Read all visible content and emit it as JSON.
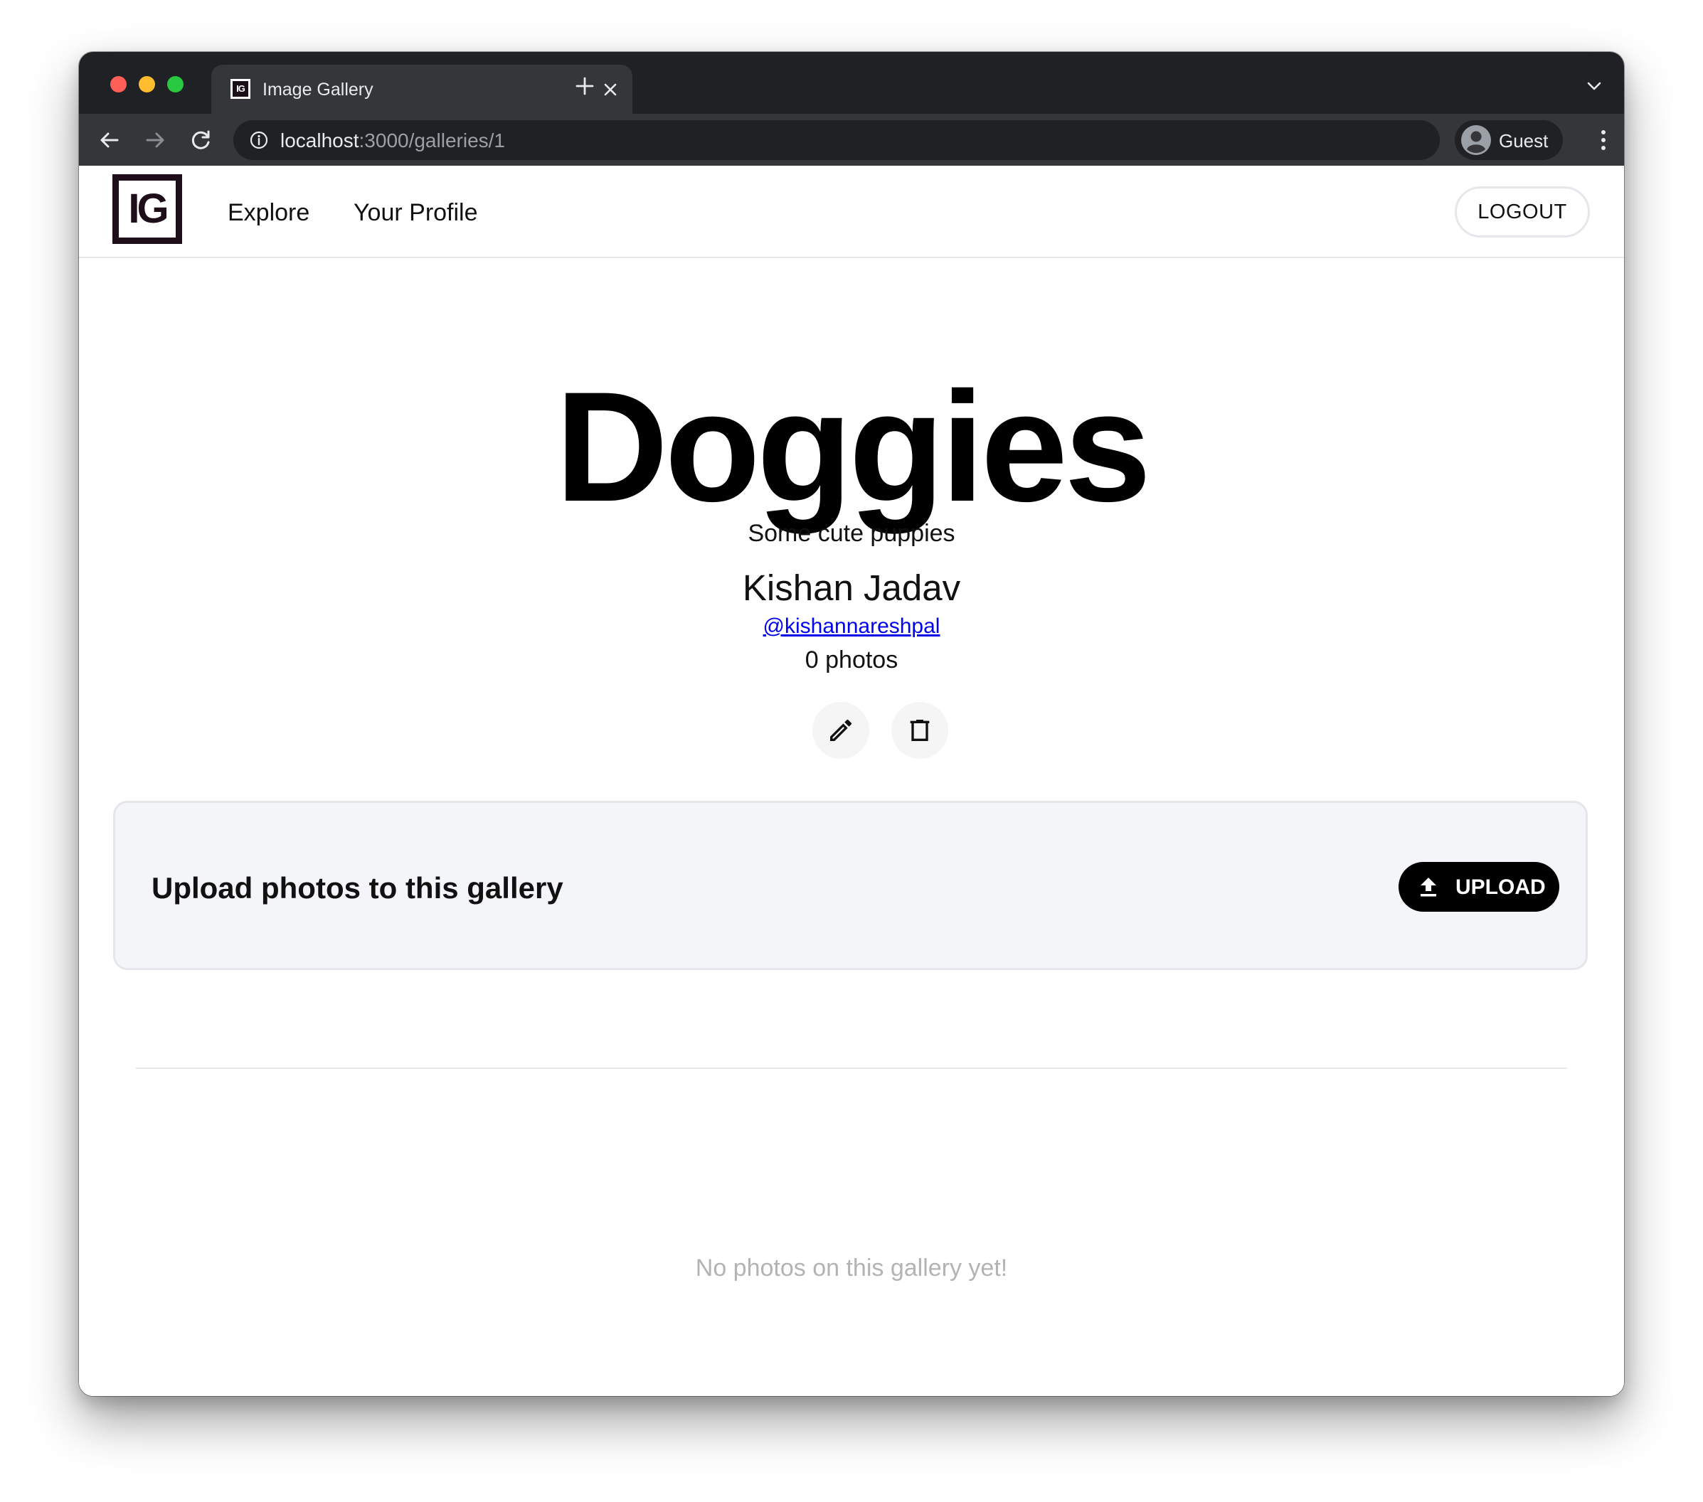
{
  "browser": {
    "tab_title": "Image Gallery",
    "url_host": "localhost",
    "url_path": ":3000/galleries/1",
    "profile_name": "Guest"
  },
  "nav": {
    "logo_text": "IG",
    "links": [
      {
        "label": "Explore"
      },
      {
        "label": "Your Profile"
      }
    ],
    "logout_label": "LOGOUT"
  },
  "gallery": {
    "title": "Doggies",
    "description": "Some cute puppies",
    "owner_name": "Kishan Jadav",
    "owner_handle": "@kishannareshpal",
    "photo_count": "0 photos"
  },
  "upload": {
    "heading": "Upload photos to this gallery",
    "button_label": "UPLOAD"
  },
  "empty_state": "No photos on this gallery yet!",
  "icons": {
    "edit": "pencil-icon",
    "delete": "trash-icon",
    "upload": "upload-icon"
  },
  "colors": {
    "brand": "#1d0e1a",
    "link": "#0000ee",
    "upload_card_bg": "#f4f5f8"
  }
}
